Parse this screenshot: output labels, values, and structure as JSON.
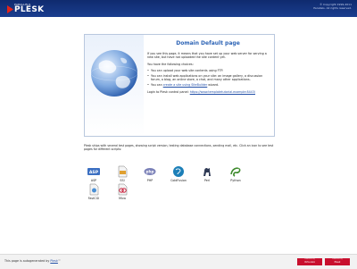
{
  "header": {
    "brand_small": "PARALLELS",
    "brand": "PLESK",
    "copyright_line1": "© Copyright 1999-2011",
    "copyright_line2": "Parallels. All rights reserved."
  },
  "panel": {
    "title": "Domain Default page",
    "intro": "If you see this page, it means that you have set up your web server for serving a new site, but have not uploaded the site content yet.",
    "choices_heading": "You have the following choices:",
    "choice_1": "You can upload your web site contents using FTP.",
    "choice_2": "You can install web applications on your site: an image gallery, a discussion forum, a blog, an online store, a chat, and many other applications.",
    "choice_3_pre": "You can ",
    "choice_3_link": "create a site using SiteBuilder",
    "choice_3_post": " wizard.",
    "login_label": "Login to Plesk control panel: ",
    "login_url": "https://www.templatetutorial.example:8443/"
  },
  "scripts": {
    "intro": "Plesk ships with several test pages, showing script version, testing database connections, sending mail, etc. Click an icon to see test pages for different scripts:",
    "items": [
      {
        "label": "ASP",
        "icon": "asp-icon"
      },
      {
        "label": "SSI",
        "icon": "ssi-icon"
      },
      {
        "label": "PHP",
        "icon": "php-icon"
      },
      {
        "label": "ColdFusion",
        "icon": "coldfusion-icon"
      },
      {
        "label": "Perl",
        "icon": "perl-icon"
      },
      {
        "label": "Python",
        "icon": "python-icon"
      },
      {
        "label": "FastCGI",
        "icon": "fastcgi-icon"
      },
      {
        "label": "Miva",
        "icon": "miva-icon"
      }
    ]
  },
  "footer": {
    "text_pre": "This page is autogenerated by ",
    "text_link": "Plesk",
    "text_post": "™",
    "badge1_small": "Powered by",
    "badge1": "Virtuozzo",
    "badge2_small": "Powered by",
    "badge2": "Plesk"
  }
}
